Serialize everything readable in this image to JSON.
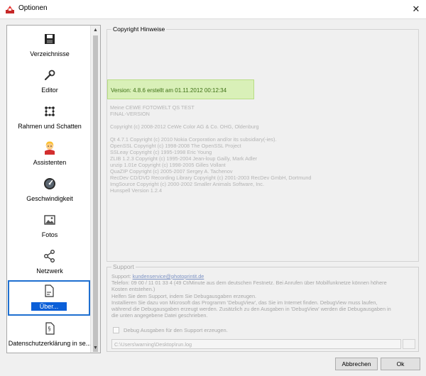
{
  "window": {
    "title": "Optionen",
    "icon": "cewe-app-icon",
    "close_symbol": "✕"
  },
  "sidebar": {
    "items": [
      {
        "label": "Verzeichnisse",
        "icon": "floppy-disk-icon"
      },
      {
        "label": "Editor",
        "icon": "wrench-icon"
      },
      {
        "label": "Rahmen und Schatten",
        "icon": "frame-dots-icon"
      },
      {
        "label": "Assistenten",
        "icon": "assistant-avatar-icon"
      },
      {
        "label": "Geschwindigkeit",
        "icon": "speedometer-icon"
      },
      {
        "label": "Fotos",
        "icon": "photo-icon"
      },
      {
        "label": "Netzwerk",
        "icon": "network-nodes-icon"
      },
      {
        "label": "Über...",
        "icon": "document-icon",
        "selected": true
      },
      {
        "label": "Datenschutzerklärung in se...",
        "icon": "paragraph-document-icon"
      }
    ],
    "scroll_up_symbol": "▲",
    "scroll_down_symbol": "▼"
  },
  "copyright": {
    "group_title": "Copyright Hinweise",
    "version": "Version: 4.8.6 erstellt am 01.11.2012 00:12:34",
    "lines": [
      "Meine CEWE FOTOWELT QS TEST",
      "FINAL-VERSION",
      "",
      "Copyright (c) 2008-2012 CeWe Color AG & Co. OHG, Oldenburg",
      "",
      "Qt 4.7.1 Copyright (c) 2010 Nokia Corporation and/or its subsidiary(-ies).",
      "OpenSSL Copyright (c) 1998-2008 The OpenSSL Project",
      "SSLeay Copyright (c) 1995-1998 Eric Young",
      "ZLIB 1.2.3 Copyright (c) 1995-2004 Jean-loup Gailly, Mark Adler",
      "unzip 1.01e Copyright (c) 1998-2005 Gilles Vollant",
      "QuaZIP Copyright (c) 2005-2007 Sergey A. Tachenov",
      "RecDev CD/DVD Recording Library Copyright (c) 2001-2003 RecDev GmbH, Dortmund",
      "ImgSource Copyright (c) 2000-2002 Smaller Animals Software, Inc.",
      "Hunspell Version 1.2.4"
    ]
  },
  "support": {
    "group_title": "Support",
    "label_prefix": "Support: ",
    "email": "kundenservice@photoprintit.de",
    "phone_line1": "Telefon: 09 00 / 11 01 33 4 (49 Ct/Minute aus dem deutschen Festnetz. Bei Anrufen über Mobilfunknetze können höhere",
    "phone_line2": "Kosten entstehen.)",
    "help_line1": "Helfen Sie dem Support, indem Sie Debugausgaben erzeugen.",
    "help_line2": "Installieren Sie dazu von Microsoft das Programm 'DebugView', das Sie im Internet finden. DebugView muss laufen,",
    "help_line3": "während die Debugausgaben erzeugt werden. Zusätzlich zu den Ausgaben in 'DebugView' werden die Debugausgaben in",
    "help_line4": "die unten angegebene Datei geschrieben.",
    "checkbox_label": "Debug Ausgaben für den Support erzeugen.",
    "checkbox_checked": false,
    "log_path": "C:\\Users\\warning\\Desktop\\run.log"
  },
  "buttons": {
    "cancel": "Abbrechen",
    "ok": "Ok"
  }
}
